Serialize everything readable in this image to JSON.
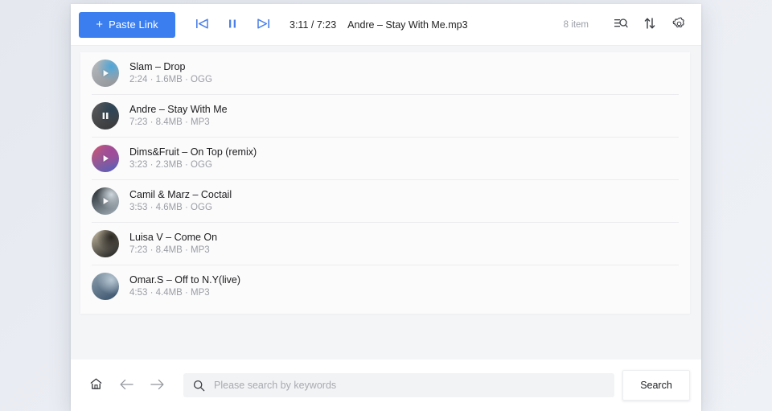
{
  "toolbar": {
    "paste_label": "Paste Link",
    "plus_glyph": "+",
    "prev_icon": "previous-track-icon",
    "pause_icon": "pause-icon",
    "next_icon": "next-track-icon",
    "time": "3:11 / 7:23",
    "now_playing": "Andre – Stay With Me.mp3",
    "item_count": "8 item",
    "filter_icon": "list-search-icon",
    "sort_icon": "sort-icon",
    "settings_icon": "gear-icon",
    "accent_color": "#3b7ef0"
  },
  "tracks": [
    {
      "title": "Slam – Drop",
      "sub": "2:24 · 1.6MB · OGG",
      "duration": "2:24",
      "size": "1.6MB",
      "format": "OGG",
      "state": "play",
      "art": "grey-blue-disc",
      "art_from": "#b9bcbf",
      "art_to": "#8f9398",
      "art_accent": "#4ea6d8"
    },
    {
      "title": "Andre – Stay With Me",
      "sub": "7:23 · 8.4MB · MP3",
      "duration": "7:23",
      "size": "8.4MB",
      "format": "MP3",
      "state": "pause",
      "art": "dark-grey-disc",
      "art_from": "#5a5c5e",
      "art_to": "#343638",
      "art_accent": "#2b4456"
    },
    {
      "title": "Dims&Fruit – On Top (remix)",
      "sub": "3:23 · 2.3MB · OGG",
      "duration": "3:23",
      "size": "2.3MB",
      "format": "OGG",
      "state": "play",
      "art": "pink-purple-gradient",
      "art_from": "#d4546f",
      "art_to": "#4d5fc0",
      "art_accent": "#a14a9a"
    },
    {
      "title": "Camil & Marz – Coctail",
      "sub": "3:53 · 4.6MB · OGG",
      "duration": "3:53",
      "size": "4.6MB",
      "format": "OGG",
      "state": "play",
      "art": "dark-blue-abstract",
      "art_from": "#1d2328",
      "art_to": "#a8b4bd",
      "art_accent": "#cfd8de"
    },
    {
      "title": "Luisa V – Come On",
      "sub": "7:23 · 8.4MB · MP3",
      "duration": "7:23",
      "size": "8.4MB",
      "format": "MP3",
      "state": "none",
      "art": "dark-beige-photo",
      "art_from": "#c8bda4",
      "art_to": "#17181a",
      "art_accent": "#2a2722"
    },
    {
      "title": "Omar.S – Off to N.Y(live)",
      "sub": "4:53 · 4.4MB · MP3",
      "duration": "4:53",
      "size": "4.4MB",
      "format": "MP3",
      "state": "none",
      "art": "blue-sky-globe",
      "art_from": "#8fa0ae",
      "art_to": "#36506a",
      "art_accent": "#b9c8d4"
    }
  ],
  "footer": {
    "home_icon": "home-icon",
    "back_icon": "arrow-left-icon",
    "forward_icon": "arrow-right-icon",
    "search_icon": "search-icon",
    "search_value": "",
    "search_placeholder": "Please search by keywords",
    "search_button": "Search"
  }
}
